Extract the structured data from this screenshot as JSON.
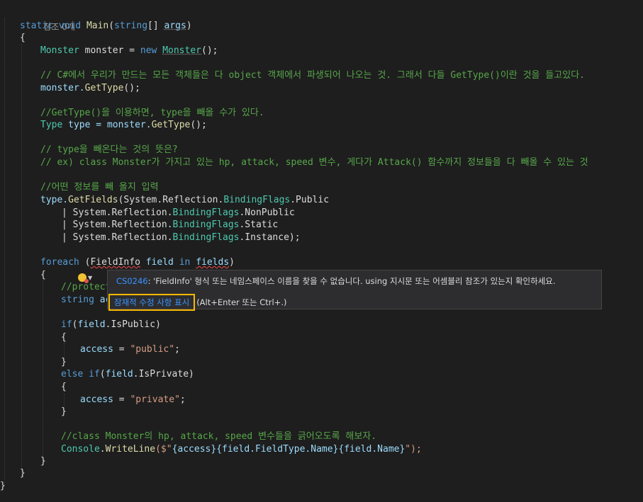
{
  "editor": {
    "ref_count": "참조 0개",
    "lines": {
      "sig_static": "static",
      "sig_void": "void",
      "sig_main": "Main",
      "sig_open": "(",
      "sig_string": "string",
      "sig_brackets": "[] ",
      "sig_args": "args",
      "sig_close": ")",
      "brace_open": "{",
      "l_monster_type": "Monster",
      "l_monster_var": " monster = ",
      "l_new": "new",
      "l_monster_ctor": "Monster",
      "l_monster_end": "();",
      "c1": "// C#에서 우리가 만드는 모든 객체들은 다 object 객체에서 파생되어 나오는 것. 그래서 다들 GetType()이란 것을 들고있다.",
      "l_gettype_obj": "monster.",
      "l_gettype_fn": "GetType",
      "l_gettype_end": "();",
      "c2": "//GetType()을 이용하면, type을 빼올 수가 있다.",
      "l_type_ty": "Type",
      "l_type_var": " type = ",
      "l_type_obj": "monster.",
      "l_type_fn": "GetType",
      "l_type_end": "();",
      "c3": "// type을 빼온다는 것의 뜻은?",
      "c4": "// ex) class Monster가 가지고 있는 hp, attack, speed 변수, 게다가 Attack() 함수까지 정보들을 다 빼올 수 있는 것",
      "c5": "//어떤 정보를 빼 올지 입력",
      "gf_type": "type.",
      "gf_fn": "GetFields",
      "gf_open": "(System.Reflection.",
      "gf_bf": "BindingFlags",
      "gf_public": ".Public",
      "gf2_pre": "| System.Reflection.",
      "gf2_bf": "BindingFlags",
      "gf2_val": ".NonPublic",
      "gf3_pre": "| System.Reflection.",
      "gf3_bf": "BindingFlags",
      "gf3_val": ".Static",
      "gf4_pre": "| System.Reflection.",
      "gf4_bf": "BindingFlags",
      "gf4_val": ".Instance);",
      "fe_kw": "foreach",
      "fe_open": " (",
      "fe_type": "FieldInfo",
      "fe_sp": " ",
      "fe_field": "field",
      "fe_in": " in ",
      "fe_fields": "fields",
      "fe_close": ")",
      "c6": "//protect",
      "acc_kw": "string",
      "acc_var": " acc",
      "if_kw": "if",
      "if_open": "(",
      "if_field": "field",
      "if_prop": ".IsPublic",
      "if_close": ")",
      "a1_var": "access",
      "a1_eq": " = ",
      "a1_str": "\"public\"",
      "a1_end": ";",
      "brace_close": "}",
      "else_kw": "else",
      "elif_kw": " if",
      "ei_open": "(",
      "ei_field": "field",
      "ei_prop": ".IsPrivate",
      "ei_close": ")",
      "a2_var": "access",
      "a2_eq": " = ",
      "a2_str": "\"private\"",
      "a2_end": ";",
      "c7": "//class Monster의 hp, attack, speed 변수들을 긁어오도록 해보자.",
      "cw_ty": "Console",
      "cw_dot": ".",
      "cw_fn": "WriteLine",
      "cw_open": "($\"",
      "cw_b1": "{access}",
      "cw_b2": "{field.FieldType.Name}",
      "cw_b3": "{field.Name}",
      "cw_close": "\");"
    }
  },
  "tooltip": {
    "error_code": "CS0246",
    "message": ": 'FieldInfo' 형식 또는 네임스페이스 이름을 찾을 수 없습니다. using 지시문 또는 어셈블리 참조가 있는지 확인하세요.",
    "fix_link": "잠재적 수정 사항 표시",
    "shortcut": "(Alt+Enter 또는 Ctrl+.)"
  },
  "lightbulb": {
    "icon": "lightbulb-error-icon",
    "caret": "▼"
  },
  "colors": {
    "background": "#1e1e1e",
    "keyword": "#569cd6",
    "type": "#4ec9b0",
    "method": "#dcdcaa",
    "variable": "#9cdcfe",
    "comment": "#57a64a",
    "string": "#d69d85",
    "link": "#3794ff",
    "highlight_border": "#f5b800"
  }
}
